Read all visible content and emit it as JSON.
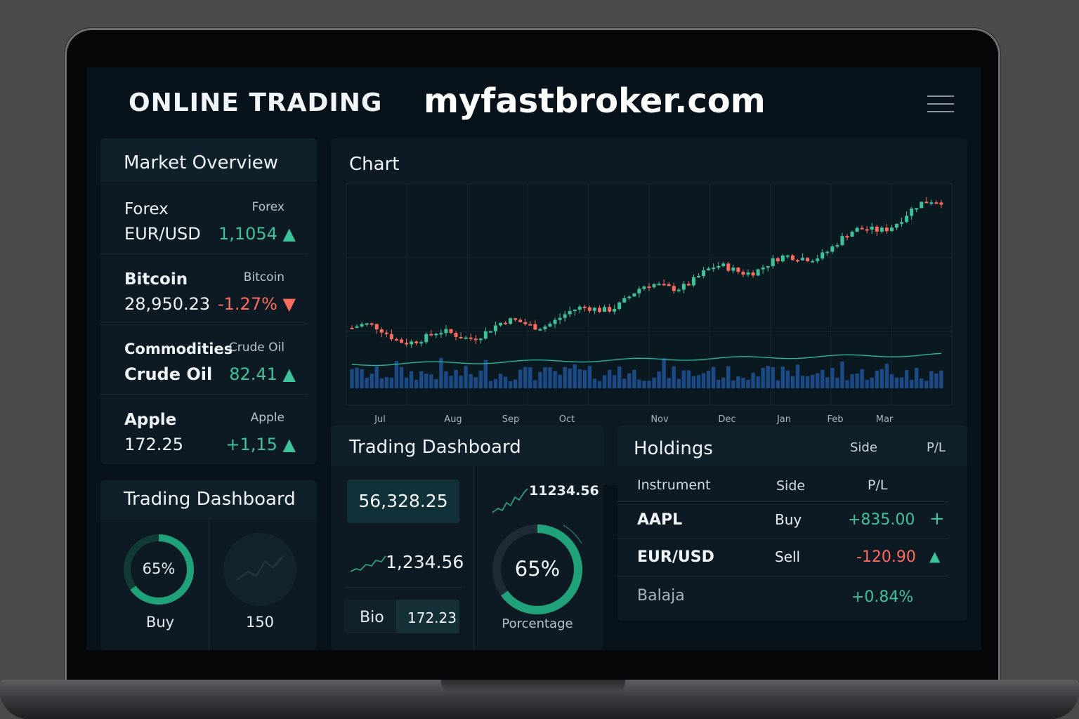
{
  "header": {
    "title": "ONLINE TRADING",
    "site": "myfastbroker.com"
  },
  "market_overview": {
    "title": "Market Overview",
    "items": [
      {
        "name": "Forex",
        "tag": "Forex",
        "symbol": "EUR/USD",
        "value": "1,1054 ▲",
        "trend": "up"
      },
      {
        "name": "Bitcoin",
        "tag": "Bitcoin",
        "symbol": "28,950.23",
        "value": "-1.27% ▼",
        "trend": "down"
      },
      {
        "name": "Commodities",
        "tag": "Crude Oil",
        "symbol": "Crude Oil",
        "value": "82.41 ▲",
        "trend": "up"
      },
      {
        "name": "Apple",
        "tag": "Apple",
        "symbol": "172.25",
        "value": "+1,15 ▲",
        "trend": "up"
      }
    ]
  },
  "mini_dashboard": {
    "title": "Trading Dashboard",
    "ring_value": "65%",
    "ring_fraction": 0.65,
    "ring_label": "Buy",
    "count_label": "150"
  },
  "chart": {
    "title": "Chart",
    "months": [
      "Jul",
      "Aug",
      "Sep",
      "Oct",
      "Nov",
      "Dec",
      "Jan",
      "Feb",
      "Mar"
    ]
  },
  "chart_data": {
    "type": "line",
    "x": [
      "Jul",
      "Aug",
      "Sep",
      "Oct",
      "Nov",
      "Dec",
      "Jan",
      "Feb",
      "Mar"
    ],
    "series": [
      {
        "values": [
          1.0,
          0.82,
          1.0,
          1.18,
          1.55,
          1.85,
          2.0,
          2.45,
          2.9
        ]
      }
    ],
    "xlabel": "",
    "ylabel": "",
    "grid": true
  },
  "trading_dashboard": {
    "title": "Trading Dashboard",
    "balance": "56,328.25",
    "mini_value": "1,234.56",
    "bio_label": "Bio",
    "bio_value": "172.23",
    "spark_value": "11234.56",
    "gauge_value": "65%",
    "gauge_fraction": 0.65,
    "gauge_label": "Porcentage"
  },
  "holdings": {
    "title": "Holdings",
    "head_side": "Side",
    "head_pl": "P/L",
    "columns": [
      "Instrument",
      "Side",
      "P/L"
    ],
    "rows": [
      {
        "instrument": "AAPL",
        "side": "Buy",
        "pl": "+835.00",
        "trend": "up",
        "action": "+"
      },
      {
        "instrument": "EUR/USD",
        "side": "Sell",
        "pl": "-120.90",
        "trend": "down",
        "action": "▲"
      },
      {
        "instrument": "Balaja",
        "side": "",
        "pl": "+0.84%",
        "trend": "up",
        "action": ""
      }
    ]
  },
  "colors": {
    "up": "#3cc39a",
    "down": "#ff6a5e",
    "volume": "#1c4a86",
    "background": "#08121a"
  }
}
